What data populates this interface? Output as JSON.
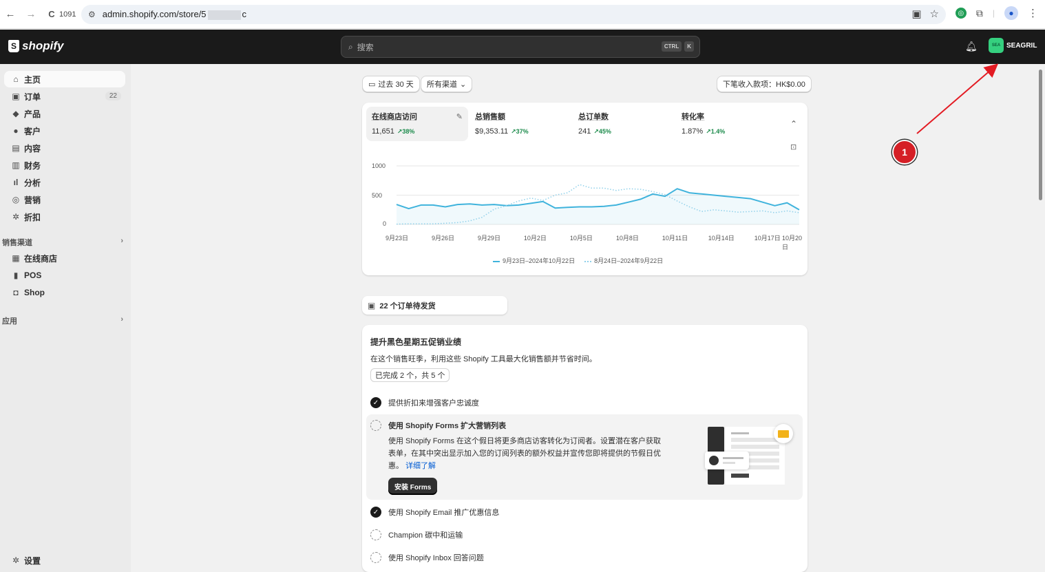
{
  "browser": {
    "back_icon": "←",
    "forward_icon": "→",
    "reload_icon": "C",
    "tab_count": "1091",
    "url_prefix": "admin.shopify.com/store/5",
    "url_suffix": "c"
  },
  "topbar": {
    "logo_text": "shopify",
    "search_placeholder": "搜索",
    "kbd_ctrl": "CTRL",
    "kbd_k": "K",
    "store_avatar": "SEA",
    "store_name": "SEAGRIL"
  },
  "sidebar": {
    "items": [
      {
        "label": "主页",
        "icon": "home-icon"
      },
      {
        "label": "订单",
        "icon": "inbox-icon",
        "badge": "22"
      },
      {
        "label": "产品",
        "icon": "tag-icon"
      },
      {
        "label": "客户",
        "icon": "person-icon"
      },
      {
        "label": "内容",
        "icon": "content-icon"
      },
      {
        "label": "财务",
        "icon": "bank-icon"
      },
      {
        "label": "分析",
        "icon": "chart-icon"
      },
      {
        "label": "营销",
        "icon": "target-icon"
      },
      {
        "label": "折扣",
        "icon": "discount-icon"
      }
    ],
    "sales_channels_label": "销售渠道",
    "channels": [
      {
        "label": "在线商店",
        "icon": "store-icon"
      },
      {
        "label": "POS",
        "icon": "pos-icon"
      },
      {
        "label": "Shop",
        "icon": "shop-icon"
      }
    ],
    "apps_label": "应用",
    "settings_label": "设置"
  },
  "filters": {
    "date_range": "过去 30 天",
    "channels": "所有渠道",
    "next_payout": "下笔收入款项：HK$0.00"
  },
  "metrics": [
    {
      "label": "在线商店访问",
      "value": "11,651",
      "change": "↗38%"
    },
    {
      "label": "总销售额",
      "value": "$9,353.11",
      "change": "↗37%"
    },
    {
      "label": "总订单数",
      "value": "241",
      "change": "↗45%"
    },
    {
      "label": "转化率",
      "value": "1.87%",
      "change": "↗1.4%"
    }
  ],
  "chart_data": {
    "type": "line",
    "yticks": [
      "1000",
      "500",
      "0"
    ],
    "ylim": [
      0,
      1000
    ],
    "x": [
      "9月23日",
      "9月26日",
      "9月29日",
      "10月2日",
      "10月5日",
      "10月8日",
      "10月11日",
      "10月14日",
      "10月17日",
      "10月20日"
    ],
    "series": [
      {
        "name": "9月23日–2024年10月22日",
        "style": "solid",
        "color": "#3fb3dc",
        "values": [
          340,
          270,
          330,
          330,
          300,
          340,
          350,
          330,
          340,
          320,
          330,
          360,
          390,
          280,
          290,
          300,
          300,
          310,
          330,
          380,
          430,
          520,
          480,
          610,
          540,
          520,
          500,
          480,
          460,
          440,
          380,
          320,
          370,
          250
        ]
      },
      {
        "name": "8月24日–2024年9月22日",
        "style": "dotted",
        "color": "#8fd0ea",
        "values": [
          5,
          10,
          10,
          10,
          20,
          30,
          60,
          120,
          260,
          320,
          400,
          450,
          410,
          500,
          540,
          680,
          620,
          620,
          580,
          610,
          600,
          560,
          510,
          400,
          300,
          220,
          250,
          230,
          210,
          220,
          230,
          200,
          230,
          200
        ]
      }
    ]
  },
  "fulfillment": {
    "label": "22 个订单待发货"
  },
  "setup_guide": {
    "title": "提升黑色星期五促销业绩",
    "subtitle": "在这个销售旺季，利用这些 Shopify 工具最大化销售额并节省时间。",
    "progress": "已完成 2 个，共 5 个",
    "tasks": [
      {
        "label": "提供折扣来增强客户忠诚度",
        "done": true
      },
      {
        "label": "使用 Shopify Forms 扩大营销列表",
        "done": false,
        "expanded": true,
        "description_1": "使用 Shopify Forms 在这个假日将更多商店访客转化为订阅者。设置潜在客户获取",
        "description_2": "表单，在其中突出显示加入您的订阅列表的额外权益并宣传您即将提供的节假日优",
        "description_3": "惠。",
        "link": "详细了解",
        "button": "安装 Forms"
      },
      {
        "label": "使用 Shopify Email 推广优惠信息",
        "done": true
      },
      {
        "label": "Champion 碳中和运输",
        "done": false
      },
      {
        "label": "使用 Shopify Inbox 回答问题",
        "done": false
      }
    ]
  },
  "annotation": {
    "number": "1",
    "color": "#d51f26"
  }
}
